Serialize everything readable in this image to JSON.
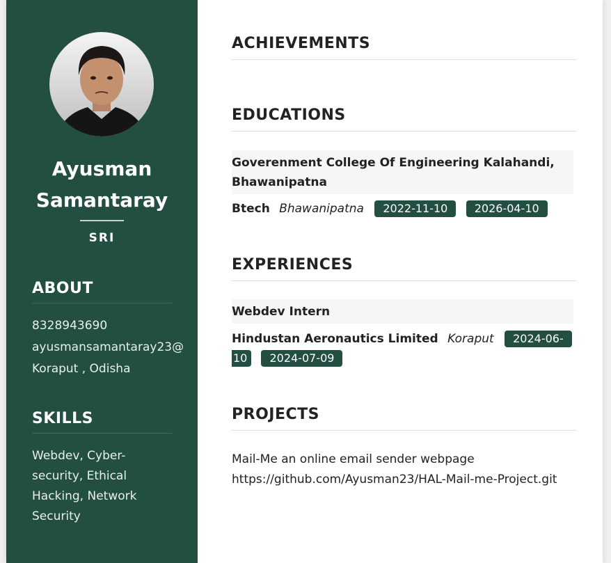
{
  "profile": {
    "name_line1": "Ayusman",
    "name_line2": "Samantaray",
    "subtitle": "SRI"
  },
  "about": {
    "heading": "ABOUT",
    "phone": "8328943690",
    "email": "ayusmansamantaray23@",
    "location": "Koraput , Odisha"
  },
  "skills": {
    "heading": "SKILLS",
    "text": "Webdev, Cyber-security, Ethical Hacking, Network Security"
  },
  "achievements": {
    "heading": "ACHIEVEMENTS"
  },
  "educations": {
    "heading": "EDUCATIONS",
    "institution": "Goverenment College Of Engineering Kalahandi, Bhawanipatna",
    "degree": "Btech",
    "location": "Bhawanipatna",
    "start": "2022-11-10",
    "end": "2026-04-10"
  },
  "experiences": {
    "heading": "EXPERIENCES",
    "role": "Webdev Intern",
    "company": "Hindustan Aeronautics Limited",
    "location": "Koraput",
    "start_part1": "2024-06-",
    "start_part2": "10",
    "end": "2024-07-09"
  },
  "projects": {
    "heading": "PROJECTS",
    "title": "Mail-Me an online email sender webpage",
    "link": "https://github.com/Ayusman23/HAL-Mail-me-Project.git"
  },
  "colors": {
    "sidebar": "#234f42",
    "badge": "#234f42"
  }
}
